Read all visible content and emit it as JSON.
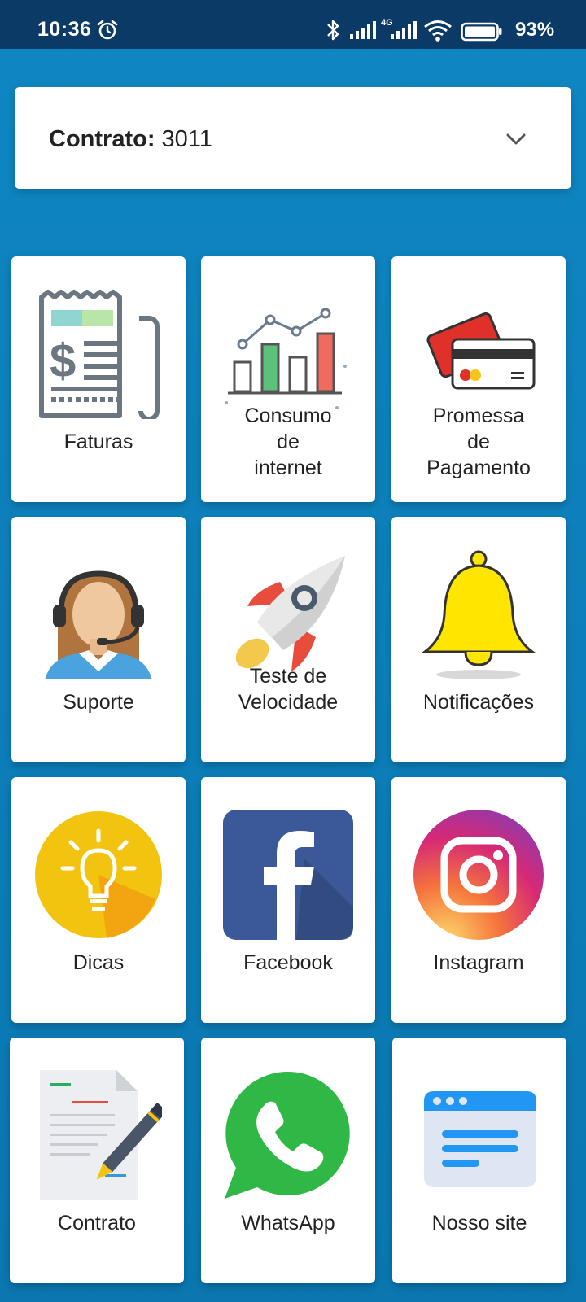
{
  "status_bar": {
    "time": "10:36",
    "network": "4G",
    "battery": "93%"
  },
  "contract_selector": {
    "label": "Contrato:",
    "value": "3011"
  },
  "tiles": [
    {
      "label": [
        "Faturas"
      ],
      "icon": "invoice-icon"
    },
    {
      "label": [
        "Consumo",
        "de",
        "internet"
      ],
      "icon": "bar-chart-icon"
    },
    {
      "label": [
        "Promessa",
        "de",
        "Pagamento"
      ],
      "icon": "credit-card-icon"
    },
    {
      "label": [
        "Suporte"
      ],
      "icon": "support-agent-icon"
    },
    {
      "label": [
        "Teste de",
        "Velocidade"
      ],
      "icon": "rocket-icon"
    },
    {
      "label": [
        "Notificações"
      ],
      "icon": "bell-icon"
    },
    {
      "label": [
        "Dicas"
      ],
      "icon": "lightbulb-icon"
    },
    {
      "label": [
        "Facebook"
      ],
      "icon": "facebook-icon"
    },
    {
      "label": [
        "Instagram"
      ],
      "icon": "instagram-icon"
    },
    {
      "label": [
        "Contrato"
      ],
      "icon": "contract-document-icon"
    },
    {
      "label": [
        "WhatsApp"
      ],
      "icon": "whatsapp-icon"
    },
    {
      "label": [
        "Nosso site"
      ],
      "icon": "website-icon"
    }
  ],
  "colors": {
    "background": "#0f86c2",
    "status_bar": "#0b3a66",
    "tile": "#ffffff"
  }
}
